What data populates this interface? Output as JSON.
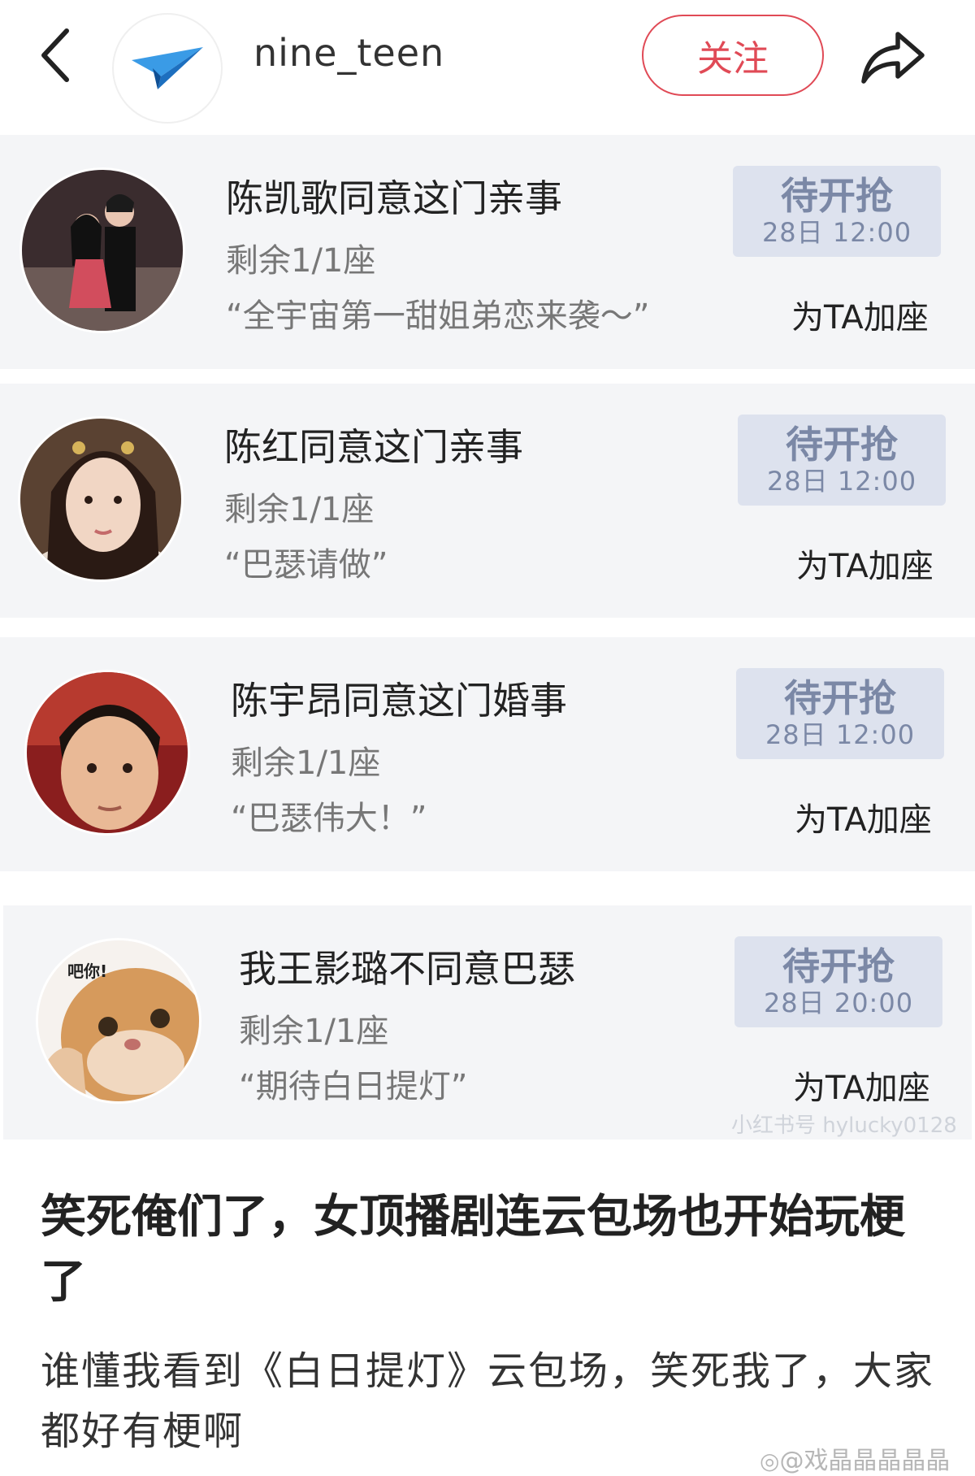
{
  "header": {
    "back_icon": "chevron-left-icon",
    "avatar_icon": "paper-plane-icon",
    "username": "nine_teen",
    "follow_label": "关注",
    "share_icon": "share-arrow-icon"
  },
  "cards": [
    {
      "title": "陈凯歌同意这门亲事",
      "remain": "剩余1/1座",
      "quote": "“全宇宙第一甜姐弟恋来袭～”",
      "status": "待开抢",
      "time": "28日 12:00",
      "add_label": "为TA加座"
    },
    {
      "title": "陈红同意这门亲事",
      "remain": "剩余1/1座",
      "quote": "“巴瑟请做”",
      "status": "待开抢",
      "time": "28日 12:00",
      "add_label": "为TA加座"
    },
    {
      "title": "陈宇昂同意这门婚事",
      "remain": "剩余1/1座",
      "quote": "“巴瑟伟大！”",
      "status": "待开抢",
      "time": "28日 12:00",
      "add_label": "为TA加座"
    },
    {
      "title": "我王影璐不同意巴瑟",
      "remain": "剩余1/1座",
      "quote": "“期待白日提灯”",
      "status": "待开抢",
      "time": "28日 20:00",
      "add_label": "为TA加座",
      "avatar_text": "吧你!"
    }
  ],
  "inner_watermark": "小红书号 hylucky0128",
  "post": {
    "title": "笑死俺们了，女顶播剧连云包场也开始玩梗了",
    "body": "谁懂我看到《白日提灯》云包场，笑死我了，大家都好有梗啊"
  },
  "bottom_watermark": "@戏晶晶晶晶晶",
  "colors": {
    "accent": "#e04a56",
    "card_bg": "#f4f5f7",
    "status_bg": "#dde2ee",
    "status_text": "#7b88a6"
  }
}
